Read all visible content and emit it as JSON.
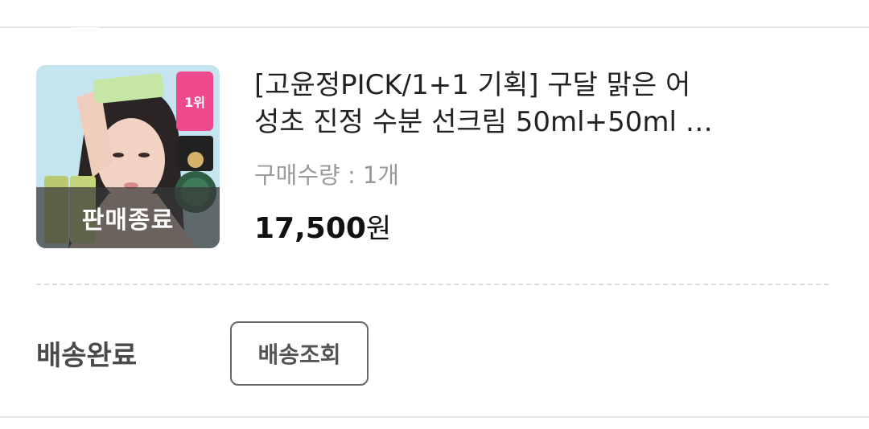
{
  "product": {
    "title_line1": "[고윤정PICK/1+1 기획] 구달 맑은 어",
    "title_line2": "성초 진정 수분 선크림 50ml+50ml …",
    "quantity": "구매수량 : 1개",
    "price_number": "17,500",
    "price_unit": "원",
    "soldout_label": "판매종료"
  },
  "delivery": {
    "status": "배송완료",
    "track_button": "배송조회"
  }
}
